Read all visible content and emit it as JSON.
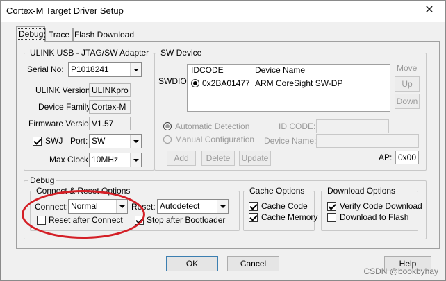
{
  "window": {
    "title": "Cortex-M Target Driver Setup",
    "close_glyph": "✕"
  },
  "tabs": [
    {
      "label": "Debug"
    },
    {
      "label": "Trace"
    },
    {
      "label": "Flash Download"
    }
  ],
  "adapter": {
    "title": "ULINK USB - JTAG/SW Adapter",
    "serial_label": "Serial No:",
    "serial_value": "P1018241",
    "ulink_version_label": "ULINK Version:",
    "ulink_version_value": "ULINKpro",
    "device_family_label": "Device Family:",
    "device_family_value": "Cortex-M",
    "firmware_label": "Firmware Version:",
    "firmware_value": "V1.57",
    "swj_label": "SWJ",
    "port_label": "Port:",
    "port_value": "SW",
    "max_clock_label": "Max Clock:",
    "max_clock_value": "10MHz"
  },
  "sw_device": {
    "title": "SW Device",
    "row_label": "SWDIO",
    "columns": [
      "IDCODE",
      "Device Name"
    ],
    "rows": [
      {
        "idcode": "0x2BA01477",
        "device_name": "ARM CoreSight SW-DP"
      }
    ],
    "move_label": "Move",
    "up_label": "Up",
    "down_label": "Down",
    "automatic_label": "Automatic Detection",
    "manual_label": "Manual Configuration",
    "id_code_label": "ID CODE:",
    "device_name_label": "Device Name:",
    "add_label": "Add",
    "delete_label": "Delete",
    "update_label": "Update",
    "ap_label": "AP:",
    "ap_value": "0x00"
  },
  "debug": {
    "title": "Debug",
    "connect_reset_title": "Connect & Reset Options",
    "connect_label": "Connect:",
    "connect_value": "Normal",
    "reset_label": "Reset:",
    "reset_value": "Autodetect",
    "reset_after_connect_label": "Reset after Connect",
    "stop_after_bootloader_label": "Stop after Bootloader",
    "cache_title": "Cache Options",
    "cache_code_label": "Cache Code",
    "cache_memory_label": "Cache Memory",
    "download_title": "Download Options",
    "verify_label": "Verify Code Download",
    "download_flash_label": "Download to Flash"
  },
  "buttons": {
    "ok": "OK",
    "cancel": "Cancel",
    "help": "Help"
  },
  "watermark": "CSDN @bookbyhay",
  "colors": {
    "annotation": "#d41f26",
    "focus_border": "#3c7fb1"
  }
}
